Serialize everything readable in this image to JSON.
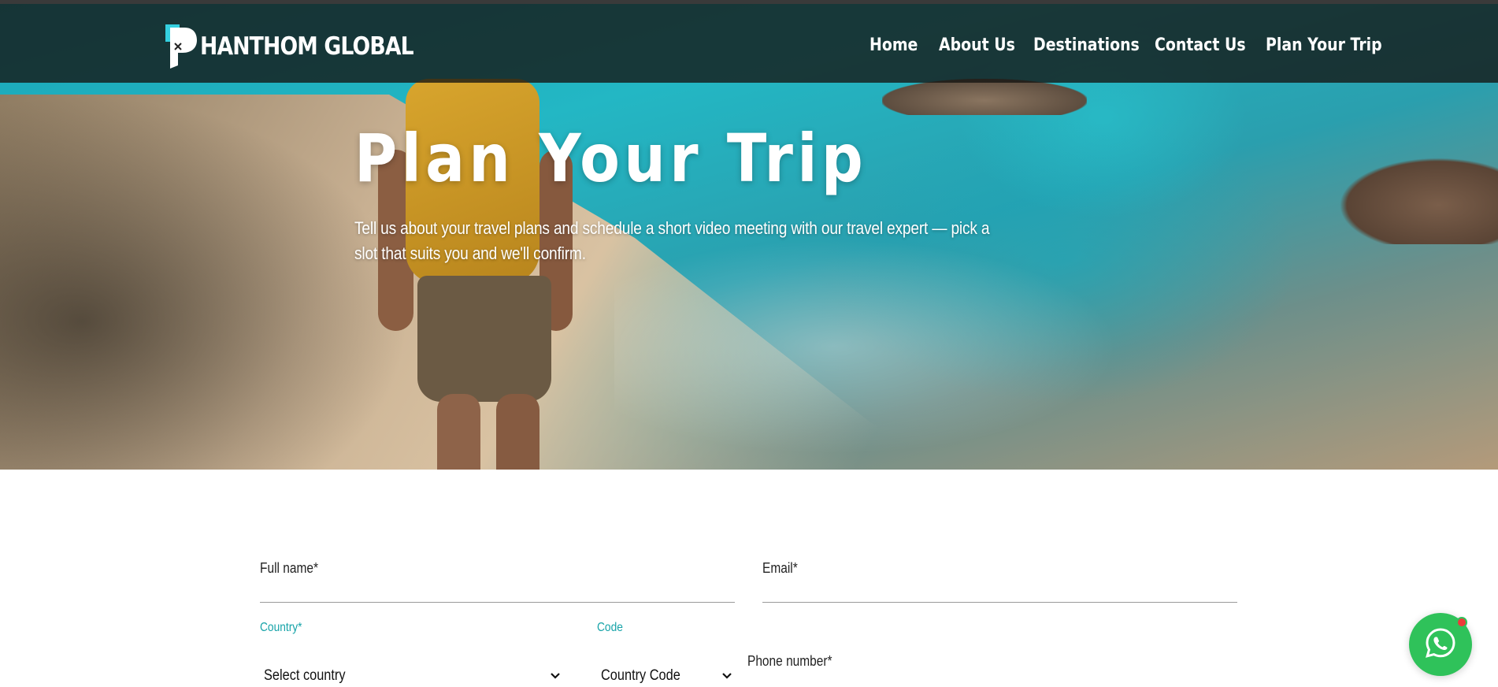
{
  "brand": {
    "name": "HANTHOM GLOBAL"
  },
  "nav": {
    "items": [
      {
        "label": "Home"
      },
      {
        "label": "About Us"
      },
      {
        "label": "Destinations"
      },
      {
        "label": "Contact Us"
      },
      {
        "label": "Plan Your Trip"
      }
    ]
  },
  "hero": {
    "title": "Plan Your Trip",
    "subtitle": "Tell us about your travel plans and schedule a short video meeting with our travel expert — pick a slot that suits you and we'll confirm."
  },
  "form": {
    "full_name_label": "Full name*",
    "email_label": "Email*",
    "country_label": "Country*",
    "country_value": "Select country",
    "code_label": "Code",
    "code_value": "Country Code",
    "phone_label": "Phone number*"
  },
  "colors": {
    "accent_teal": "#16a3a8",
    "whatsapp_green": "#2fc25a",
    "notification_red": "#ee3a3a"
  },
  "icons": [
    "whatsapp-icon",
    "chevron-down-icon"
  ]
}
